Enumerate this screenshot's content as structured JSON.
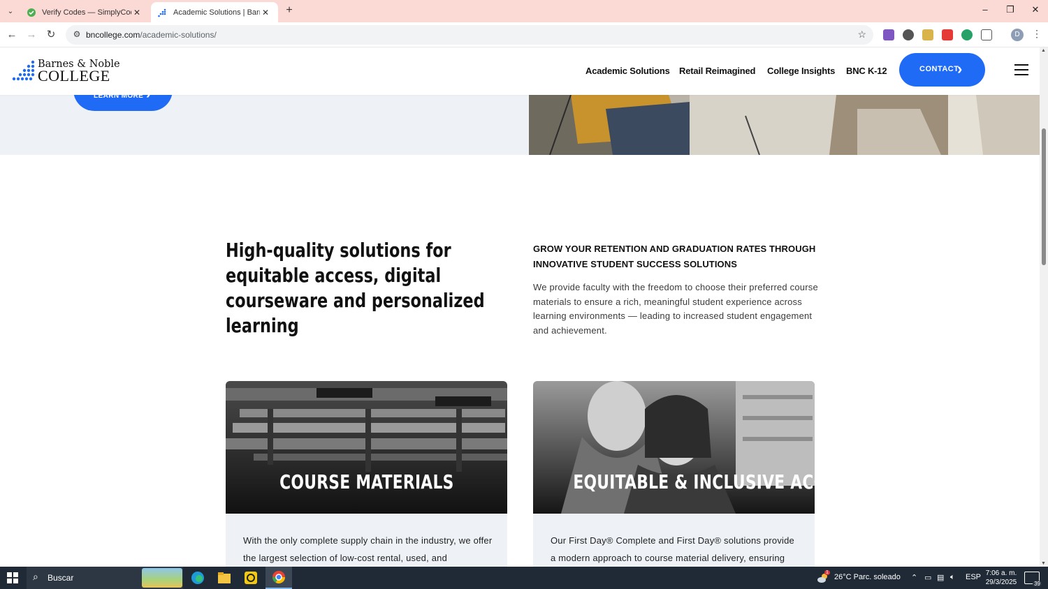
{
  "browser": {
    "tabs": [
      {
        "title": "Verify Codes — SimplyCodes",
        "active": false
      },
      {
        "title": "Academic Solutions | Barnes &",
        "active": true
      }
    ],
    "url_domain": "bncollege.com",
    "url_path": "/academic-solutions/",
    "profile_initial": "D"
  },
  "site": {
    "logo_line1": "Barnes & Noble",
    "logo_line2": "COLLEGE",
    "nav": [
      "Academic Solutions",
      "Retail Reimagined",
      "College Insights",
      "BNC K-12"
    ],
    "contact_label": "CONTACT",
    "learn_more_label": "LEARN MORE",
    "brand_blue": "#1f6bf5"
  },
  "intro": {
    "heading": "High-quality solutions for equitable access, digital courseware and personalized learning",
    "subheading": "GROW YOUR RETENTION AND GRADUATION RATES THROUGH INNOVATIVE STUDENT SUCCESS SOLUTIONS",
    "body": "We provide faculty with the freedom to choose their preferred course materials to ensure a rich, meaningful student experience across learning environments — leading to increased student engagement and achievement."
  },
  "cards": [
    {
      "title": "COURSE MATERIALS",
      "text": "With the only complete supply chain in the industry, we offer the largest selection of low-cost rental, used, and"
    },
    {
      "title": "EQUITABLE & INCLUSIVE ACCESS",
      "text": "Our First Day® Complete and First Day® solutions provide a modern approach to course material delivery, ensuring"
    }
  ],
  "taskbar": {
    "search_label": "Buscar",
    "weather": "26°C  Parc. soleado",
    "weather_badge": "1",
    "lang": "ESP",
    "time": "7:06 a. m.",
    "date": "29/3/2025",
    "notifications": "39"
  }
}
